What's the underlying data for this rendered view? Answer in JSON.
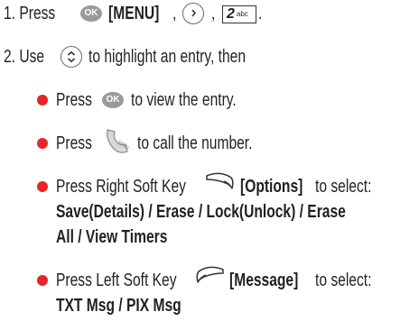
{
  "steps": {
    "step1": {
      "number": "1.",
      "press": "Press",
      "ok_key_label": "OK",
      "menu": "[MENU]",
      "comma1": ",",
      "comma2": ",",
      "key2_digit": "2",
      "key2_letters": "abc",
      "end": "."
    },
    "step2": {
      "number": "2.",
      "use": "Use",
      "highlight": "to highlight an entry, then"
    }
  },
  "bullets": {
    "view": {
      "press": "Press",
      "ok_key_label": "OK",
      "text": "to view the entry."
    },
    "call": {
      "press": "Press",
      "send_key_label": "SEND",
      "text": "to call the number."
    },
    "options": {
      "text": "Press Right Soft Key",
      "bracket": "[Options]",
      "tail": "to select:",
      "line2": "Save(Details) / Erase / Lock(Unlock) / Erase",
      "line3": "All / View Timers"
    },
    "message": {
      "text": "Press Left Soft Key",
      "bracket": "[Message]",
      "tail": "to select:",
      "line2": "TXT Msg / PIX Msg"
    }
  },
  "colors": {
    "text": "#231f20",
    "bullet": "#e4262a",
    "ok_key": "#9a9a9a"
  },
  "icons": {
    "ok": "ok-key-icon",
    "nav": "nav-key-icon",
    "num2": "key-2abc-icon",
    "up_down": "up-down-nav-icon",
    "send": "send-key-icon",
    "right_soft": "right-soft-key-icon",
    "left_soft": "left-soft-key-icon"
  }
}
